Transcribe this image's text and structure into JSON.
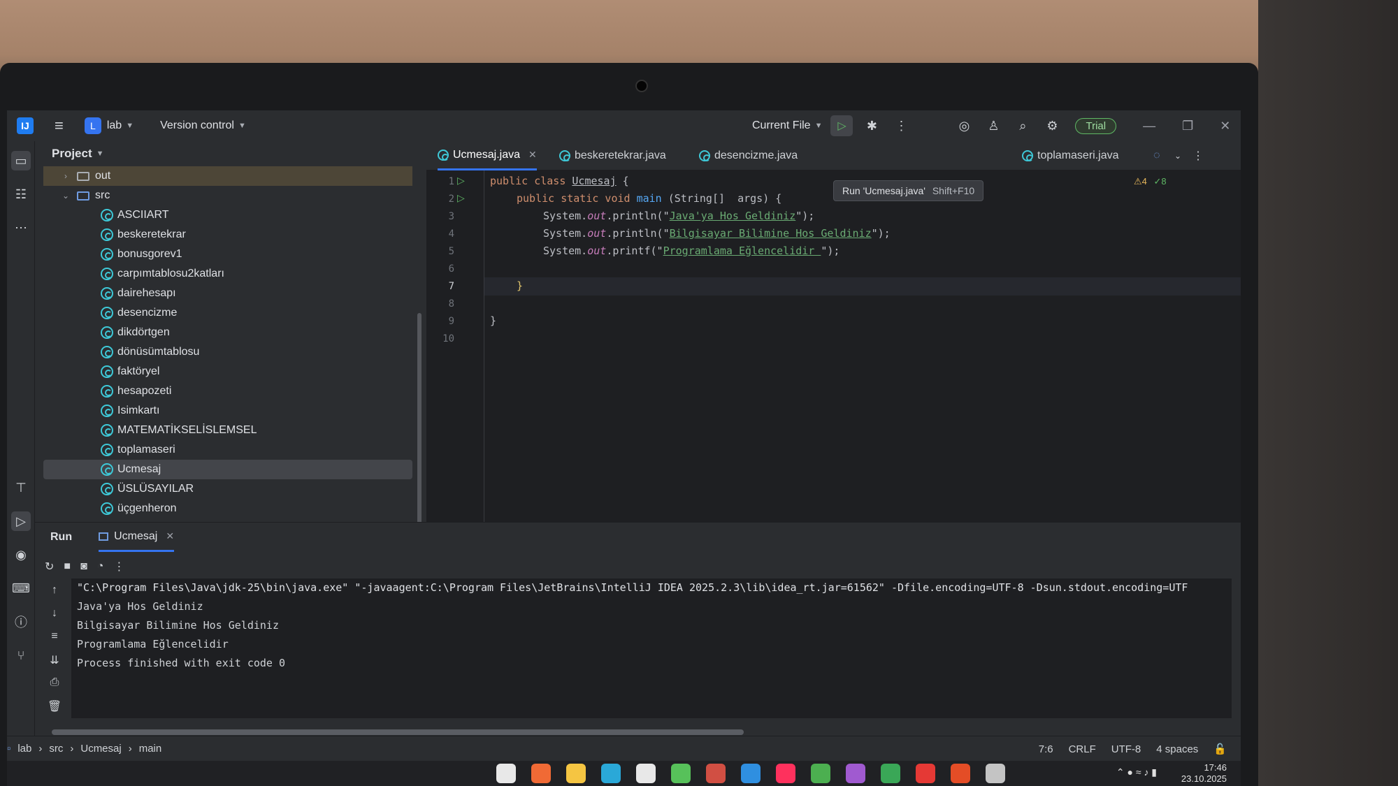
{
  "titlebar": {
    "project_badge": "L",
    "project_name": "lab",
    "version_control": "Version control",
    "run_config": "Current File",
    "trial": "Trial"
  },
  "project_panel": {
    "title": "Project",
    "folders": [
      "out",
      "src"
    ],
    "files": [
      "ASCIIART",
      "beskeretekrar",
      "bonusgorev1",
      "carpımtablosu2katları",
      "dairehesapı",
      "desencizme",
      "dikdörtgen",
      "dönüsümtablosu",
      "faktöryel",
      "hesapozeti",
      "Isimkartı",
      "MATEMATİKSELİSLEMSEL",
      "toplamaseri",
      "Ucmesaj",
      "ÜSLÜSAYILAR",
      "üçgenheron"
    ],
    "selected": "Ucmesaj"
  },
  "editor": {
    "tabs": [
      "Ucmesaj.java",
      "beskeretekrar.java",
      "desencizme.java",
      "toplamaseri.java"
    ],
    "active_tab": "Ucmesaj.java",
    "tooltip": "Run 'Ucmesaj.java'",
    "tooltip_shortcut": "Shift+F10",
    "inspections": {
      "warnings": "4",
      "ok": "8"
    },
    "line_numbers": [
      "1",
      "2",
      "3",
      "4",
      "5",
      "6",
      "7",
      "8",
      "9",
      "10"
    ],
    "code": {
      "l1_kw": "public class ",
      "l1_name": "Ucmesaj",
      "l1_end": " {",
      "l2_a": "public static void ",
      "l2_fn": "main",
      "l2_b": " (String[]  args) {",
      "l3_pre": "System.",
      "l3_field": "out",
      "l3_mid": ".println(\"",
      "l3_str": "Java'ya Hos Geldiniz",
      "l3_end": "\");",
      "l4_str": "Bilgisayar Bilimine Hos Geldiniz",
      "l5_mid": ".printf(\"",
      "l5_str": "Programlama Eğlencelidir ",
      "l9": "}"
    }
  },
  "run_panel": {
    "title": "Run",
    "tab": "Ucmesaj",
    "console": [
      "\"C:\\Program Files\\Java\\jdk-25\\bin\\java.exe\" \"-javaagent:C:\\Program Files\\JetBrains\\IntelliJ IDEA 2025.2.3\\lib\\idea_rt.jar=61562\" -Dfile.encoding=UTF-8 -Dsun.stdout.encoding=UTF",
      "Java'ya Hos Geldiniz",
      "Bilgisayar Bilimine Hos Geldiniz",
      "Programlama Eğlencelidir",
      "Process finished with exit code 0"
    ]
  },
  "statusbar": {
    "breadcrumbs": [
      "lab",
      "src",
      "Ucmesaj",
      "main"
    ],
    "position": "7:6",
    "line_sep": "CRLF",
    "encoding": "UTF-8",
    "indent": "4 spaces"
  },
  "taskbar": {
    "time": "17:46",
    "date": "23.10.2025"
  }
}
